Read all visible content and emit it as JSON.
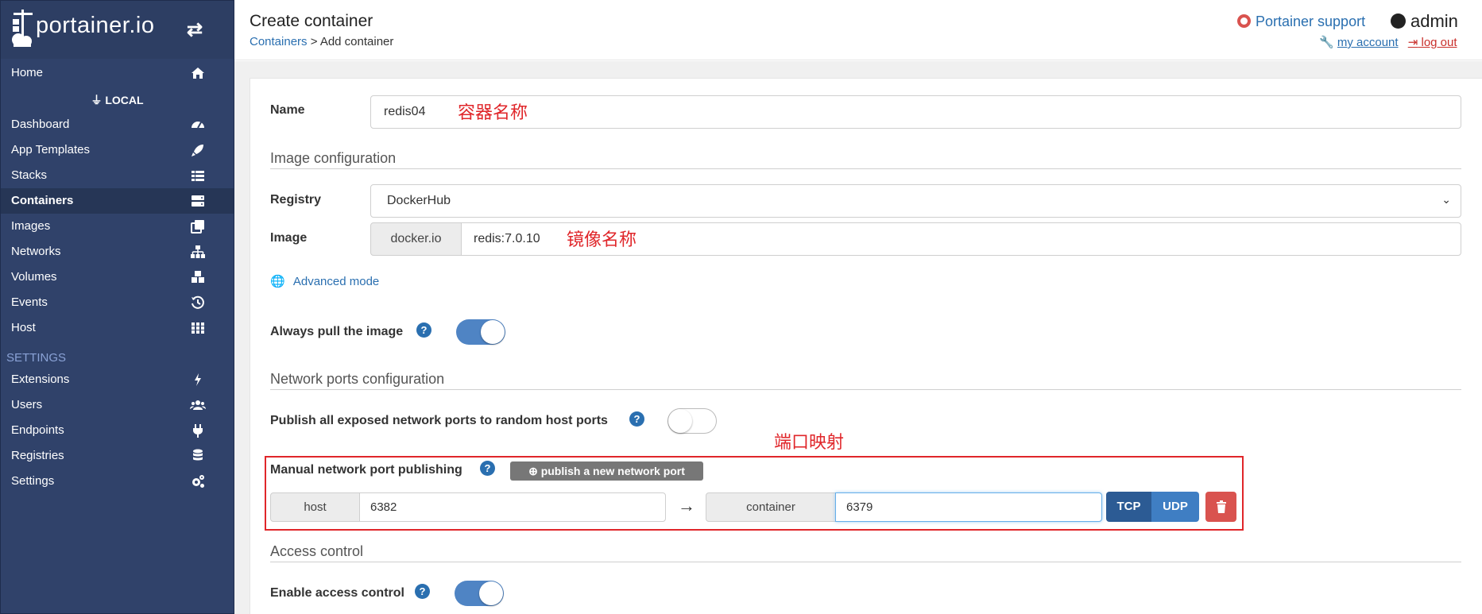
{
  "brand": {
    "name": "portainer.io"
  },
  "sidebar": {
    "home": "Home",
    "local_label": "LOCAL",
    "items": [
      "Dashboard",
      "App Templates",
      "Stacks",
      "Containers",
      "Images",
      "Networks",
      "Volumes",
      "Events",
      "Host"
    ],
    "settings_label": "SETTINGS",
    "settings_items": [
      "Extensions",
      "Users",
      "Endpoints",
      "Registries",
      "Settings"
    ]
  },
  "header": {
    "title": "Create container",
    "breadcrumb_link": "Containers",
    "breadcrumb_sep": " > ",
    "breadcrumb_current": "Add container",
    "support": "Portainer support",
    "user": "admin",
    "my_account": "my account",
    "logout": "log out"
  },
  "form": {
    "name_label": "Name",
    "name_value": "redis04",
    "name_note": "容器名称",
    "image_config_title": "Image configuration",
    "registry_label": "Registry",
    "registry_value": "DockerHub",
    "image_label": "Image",
    "image_prefix": "docker.io",
    "image_value": "redis:7.0.10",
    "image_note": "镜像名称",
    "advanced_mode": "Advanced mode",
    "always_pull_label": "Always pull the image",
    "always_pull": true,
    "network_title": "Network ports configuration",
    "publish_all_label": "Publish all exposed network ports to random host ports",
    "publish_all": false,
    "port_note": "端口映射",
    "manual_label": "Manual network port publishing",
    "publish_new_button": "publish a new network port",
    "host_addon": "host",
    "host_port": "6382",
    "container_addon": "container",
    "container_port": "6379",
    "tcp": "TCP",
    "udp": "UDP",
    "access_title": "Access control",
    "access_label": "Enable access control",
    "access_enabled": true
  },
  "colors": {
    "sidebar": "#30426a",
    "accent": "#2a6fb0",
    "danger": "#d9534f",
    "annotation": "#e0262a"
  }
}
